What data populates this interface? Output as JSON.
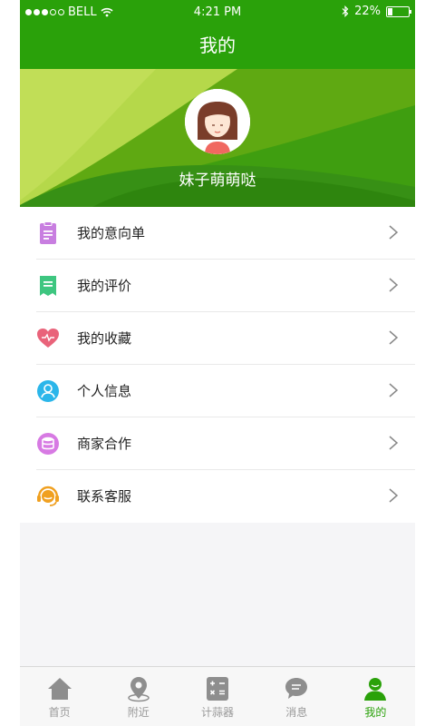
{
  "status_bar": {
    "carrier": "BELL",
    "time": "4:21 PM",
    "battery": "22%",
    "battery_level": 0.22
  },
  "header": {
    "title": "我的"
  },
  "profile": {
    "username": "妹子萌萌哒"
  },
  "menu": [
    {
      "label": "我的意向单",
      "icon": "clipboard-icon",
      "color": "#c87ee0"
    },
    {
      "label": "我的评价",
      "icon": "review-icon",
      "color": "#3ec680"
    },
    {
      "label": "我的收藏",
      "icon": "heart-icon",
      "color": "#e9637a"
    },
    {
      "label": "个人信息",
      "icon": "person-icon",
      "color": "#2bb6ea"
    },
    {
      "label": "商家合作",
      "icon": "database-icon",
      "color": "#d77ae3"
    },
    {
      "label": "联系客服",
      "icon": "headset-icon",
      "color": "#f0a020"
    }
  ],
  "tabbar": {
    "tabs": [
      {
        "label": "首页",
        "icon": "home-icon",
        "active": false
      },
      {
        "label": "附近",
        "icon": "location-pin-icon",
        "active": false
      },
      {
        "label": "计蒜器",
        "icon": "calculator-icon",
        "active": false
      },
      {
        "label": "消息",
        "icon": "message-icon",
        "active": false
      },
      {
        "label": "我的",
        "icon": "user-icon",
        "active": true
      }
    ]
  },
  "colors": {
    "brand_green": "#2aa10a",
    "inactive_gray": "#999999"
  }
}
